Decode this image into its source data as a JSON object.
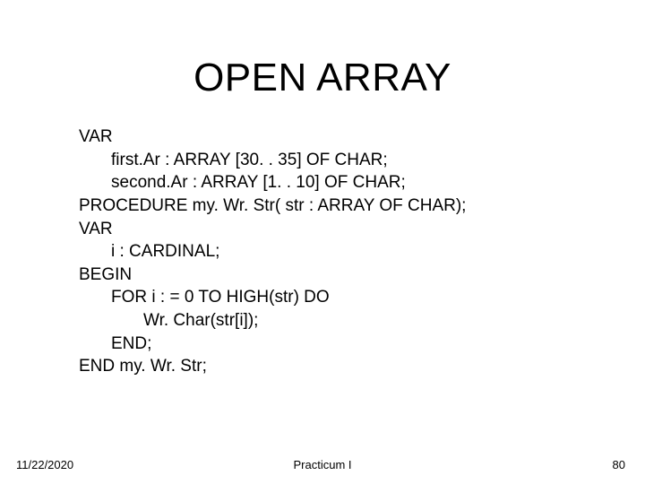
{
  "title": "OPEN ARRAY",
  "code": {
    "l0": "VAR",
    "l1": "first.Ar : ARRAY [30. . 35] OF CHAR;",
    "l2": "second.Ar : ARRAY [1. . 10] OF CHAR;",
    "l3": "PROCEDURE my. Wr. Str( str : ARRAY OF CHAR);",
    "l4": "VAR",
    "l5": "i : CARDINAL;",
    "l6": "BEGIN",
    "l7": "FOR i : = 0 TO HIGH(str) DO",
    "l8": "Wr. Char(str[i]);",
    "l9": "END;",
    "l10": "END my. Wr. Str;"
  },
  "footer": {
    "date": "11/22/2020",
    "center": "Practicum I",
    "page": "80"
  }
}
